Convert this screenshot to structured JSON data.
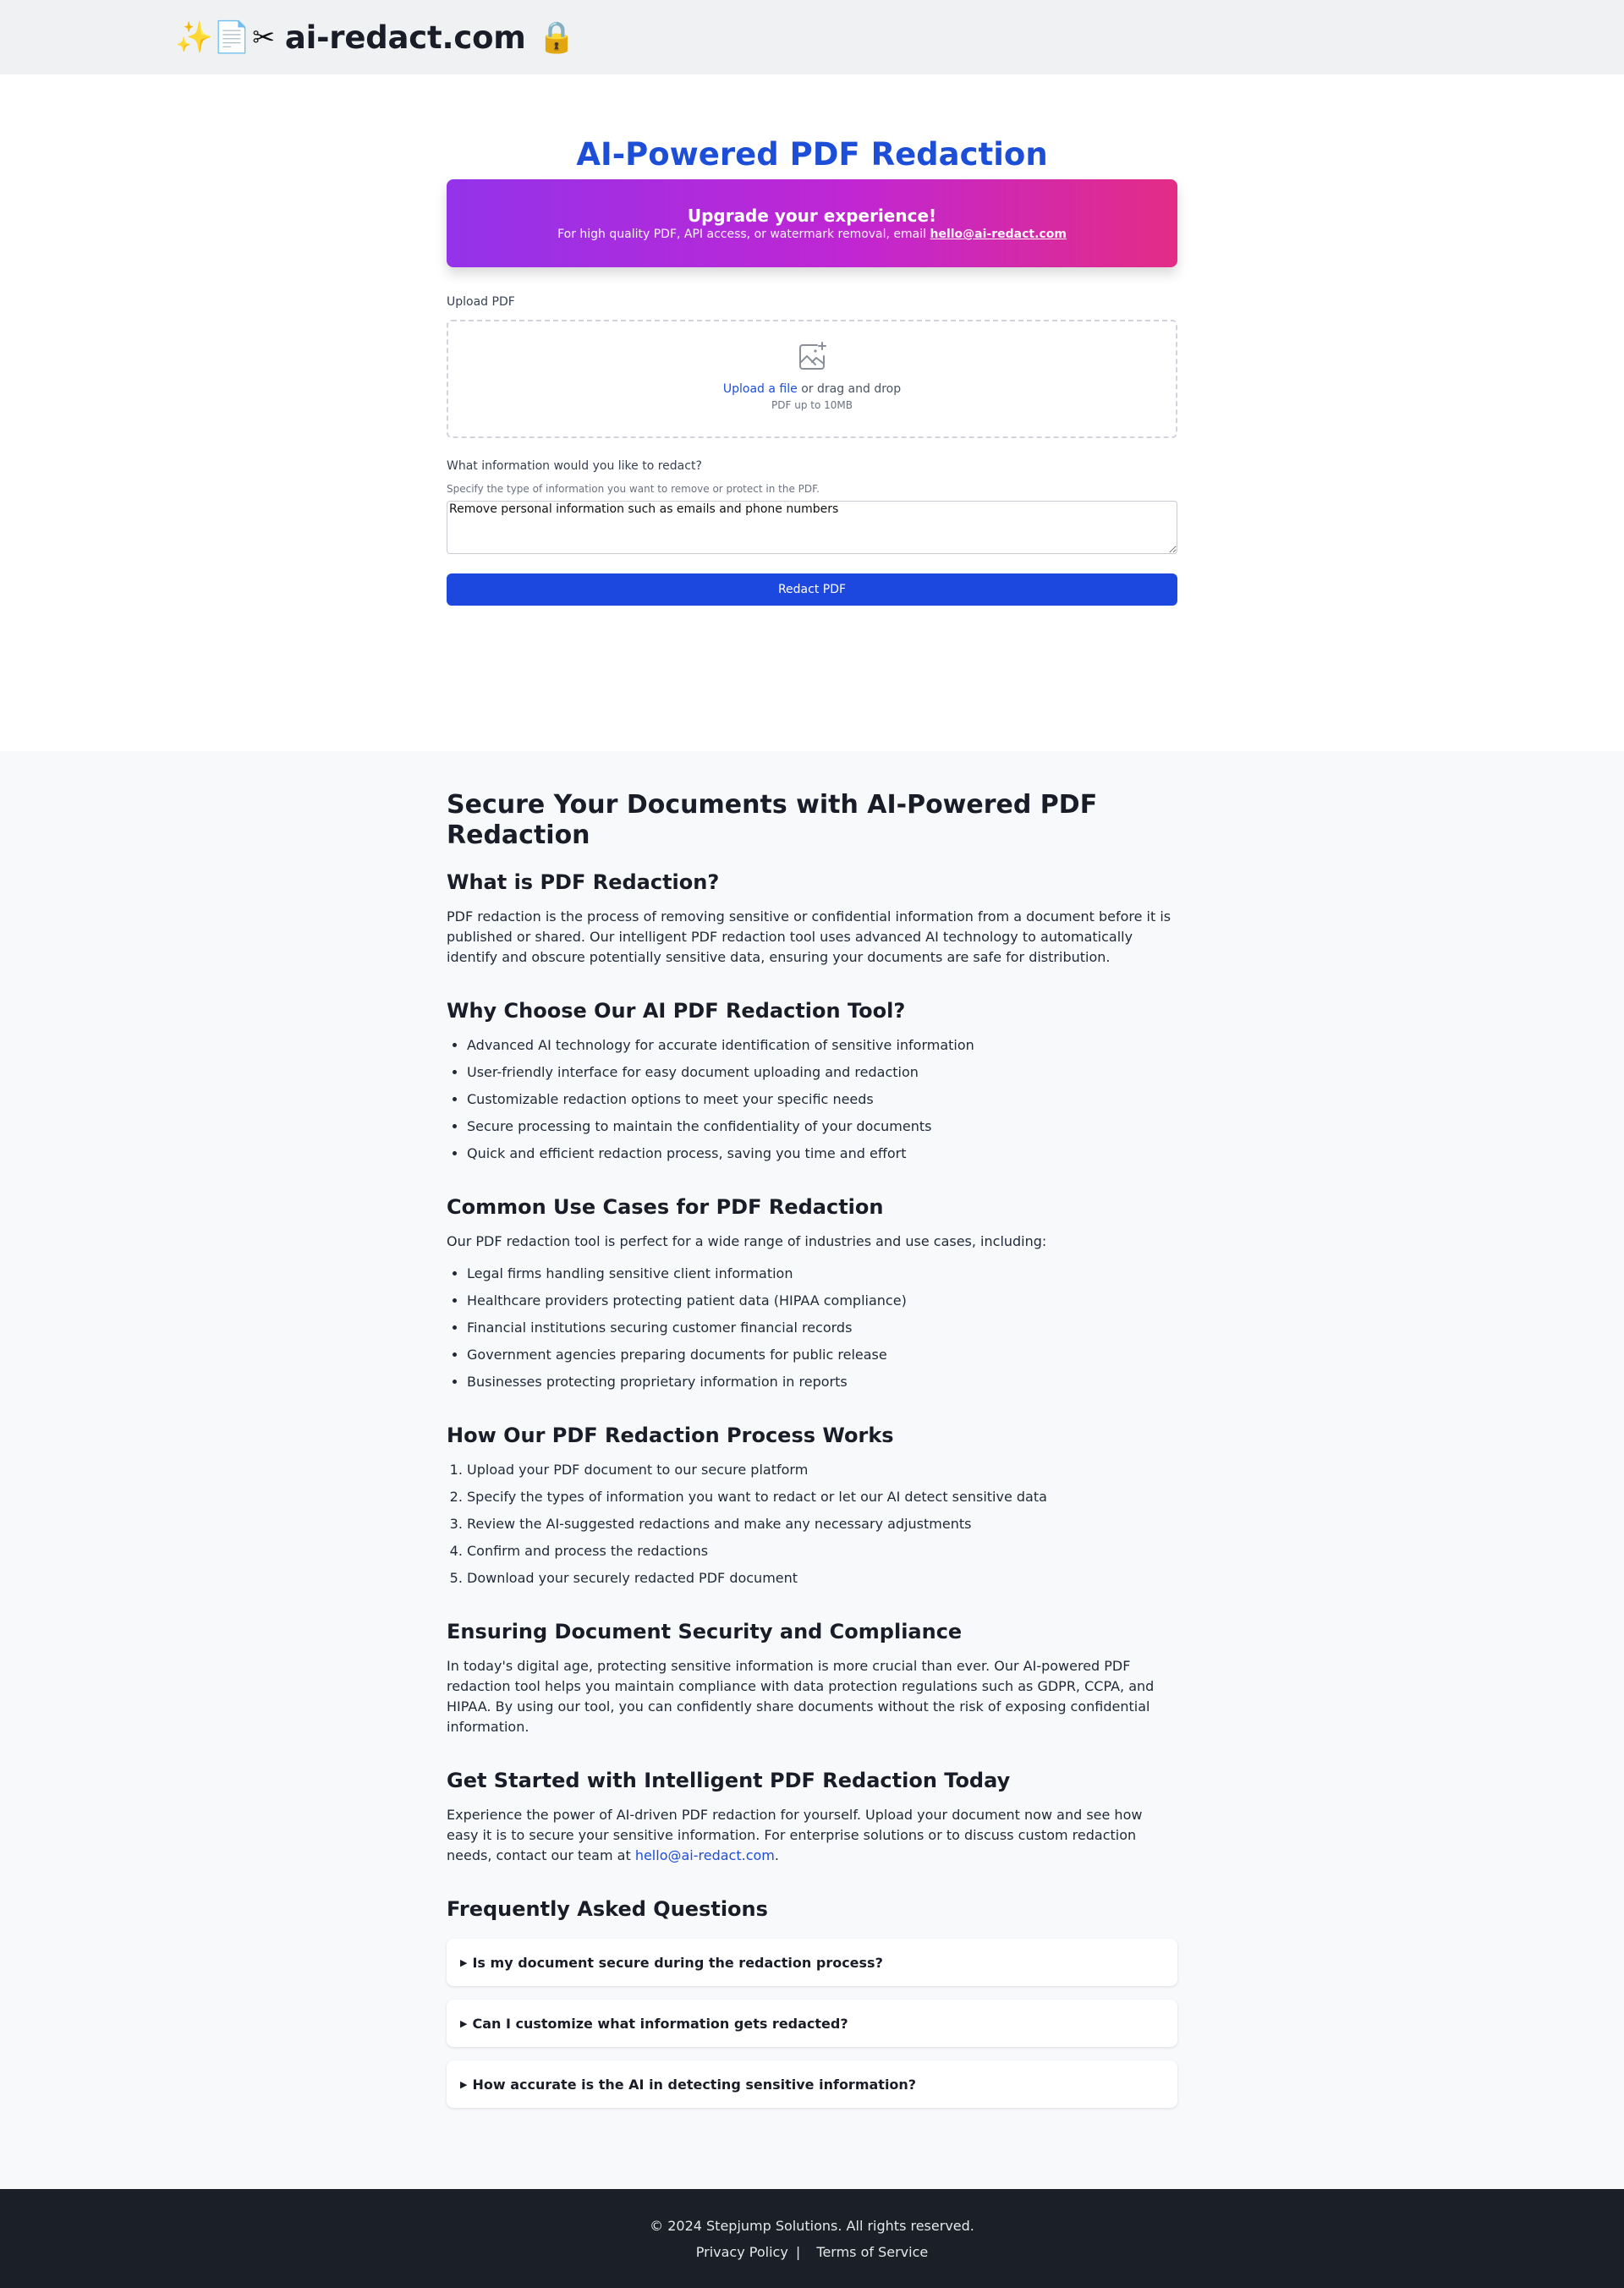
{
  "header": {
    "logo_emojis": "✨📄",
    "logo_scissors": "✂",
    "site_name": "ai-redact.com",
    "logo_lock": "🔒"
  },
  "tool": {
    "title": "AI-Powered PDF Redaction",
    "promo": {
      "title": "Upgrade your experience!",
      "text": "For high quality PDF, API access, or watermark removal, email ",
      "email": "hello@ai-redact.com"
    },
    "upload": {
      "label": "Upload PDF",
      "link_text": "Upload a file",
      "text_suffix": " or drag and drop",
      "hint": "PDF up to 10MB"
    },
    "redact_question": {
      "label": "What information would you like to redact?",
      "hint": "Specify the type of information you want to remove or protect in the PDF.",
      "value": "Remove personal information such as emails and phone numbers"
    },
    "submit_label": "Redact PDF"
  },
  "content": {
    "main_heading": "Secure Your Documents with AI-Powered PDF Redaction",
    "what_is": {
      "heading": "What is PDF Redaction?",
      "text": "PDF redaction is the process of removing sensitive or confidential information from a document before it is published or shared. Our intelligent PDF redaction tool uses advanced AI technology to automatically identify and obscure potentially sensitive data, ensuring your documents are safe for distribution."
    },
    "why_choose": {
      "heading": "Why Choose Our AI PDF Redaction Tool?",
      "items": [
        "Advanced AI technology for accurate identification of sensitive information",
        "User-friendly interface for easy document uploading and redaction",
        "Customizable redaction options to meet your specific needs",
        "Secure processing to maintain the confidentiality of your documents",
        "Quick and efficient redaction process, saving you time and effort"
      ]
    },
    "use_cases": {
      "heading": "Common Use Cases for PDF Redaction",
      "intro": "Our PDF redaction tool is perfect for a wide range of industries and use cases, including:",
      "items": [
        "Legal firms handling sensitive client information",
        "Healthcare providers protecting patient data (HIPAA compliance)",
        "Financial institutions securing customer financial records",
        "Government agencies preparing documents for public release",
        "Businesses protecting proprietary information in reports"
      ]
    },
    "process": {
      "heading": "How Our PDF Redaction Process Works",
      "steps": [
        "Upload your PDF document to our secure platform",
        "Specify the types of information you want to redact or let our AI detect sensitive data",
        "Review the AI-suggested redactions and make any necessary adjustments",
        "Confirm and process the redactions",
        "Download your securely redacted PDF document"
      ]
    },
    "security": {
      "heading": "Ensuring Document Security and Compliance",
      "text": "In today's digital age, protecting sensitive information is more crucial than ever. Our AI-powered PDF redaction tool helps you maintain compliance with data protection regulations such as GDPR, CCPA, and HIPAA. By using our tool, you can confidently share documents without the risk of exposing confidential information."
    },
    "get_started": {
      "heading": "Get Started with Intelligent PDF Redaction Today",
      "text": "Experience the power of AI-driven PDF redaction for yourself. Upload your document now and see how easy it is to secure your sensitive information. For enterprise solutions or to discuss custom redaction needs, contact our team at ",
      "email": "hello@ai-redact.com",
      "suffix": "."
    },
    "faq": {
      "heading": "Frequently Asked Questions",
      "caret": "▶",
      "items": [
        "Is my document secure during the redaction process?",
        "Can I customize what information gets redacted?",
        "How accurate is the AI in detecting sensitive information?"
      ]
    }
  },
  "footer": {
    "copyright": "© 2024 Stepjump Solutions. All rights reserved.",
    "privacy": "Privacy Policy",
    "separator": "|",
    "terms": "Terms of Service"
  },
  "colors": {
    "accent": "#1d4ed8",
    "button": "#1d48e0",
    "promo_gradient_start": "#9333ea",
    "promo_gradient_end": "#e42c86",
    "footer_bg": "#1b1f28"
  }
}
